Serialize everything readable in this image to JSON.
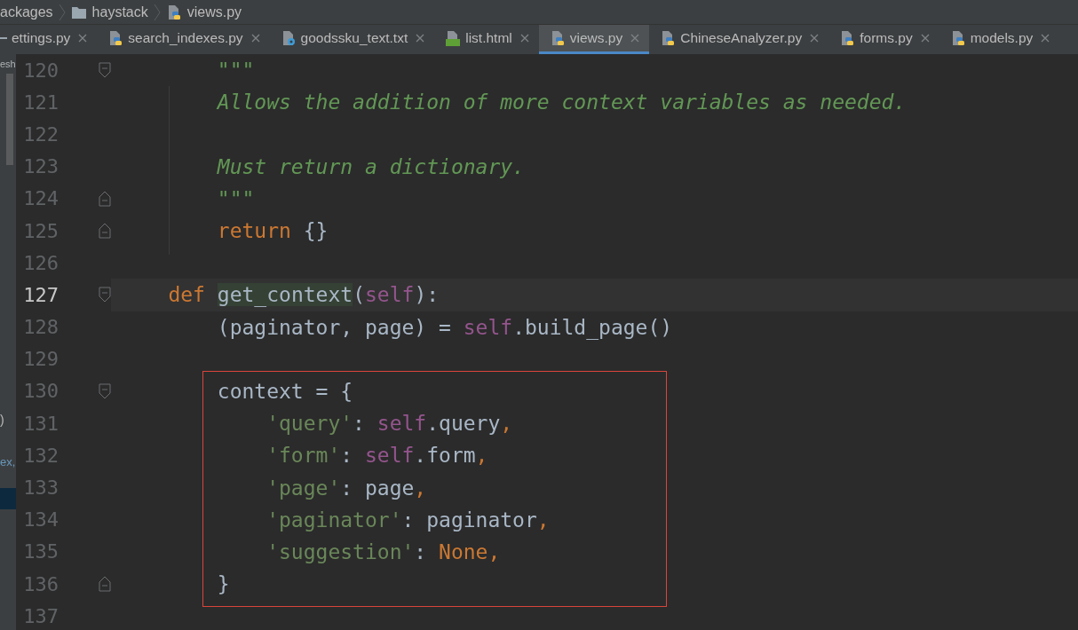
{
  "breadcrumb": [
    {
      "text": "ackages",
      "kind": "plain"
    },
    {
      "text": "haystack",
      "kind": "folder"
    },
    {
      "text": "views.py",
      "kind": "python"
    }
  ],
  "tabs": [
    {
      "label": "ettings.py",
      "kind": "cut",
      "selected": false
    },
    {
      "label": "search_indexes.py",
      "kind": "python",
      "selected": false
    },
    {
      "label": "goodssku_text.txt",
      "kind": "text",
      "selected": false
    },
    {
      "label": "list.html",
      "kind": "html",
      "selected": false
    },
    {
      "label": "views.py",
      "kind": "python",
      "selected": true
    },
    {
      "label": "ChineseAnalyzer.py",
      "kind": "python",
      "selected": false
    },
    {
      "label": "forms.py",
      "kind": "python",
      "selected": false
    },
    {
      "label": "models.py",
      "kind": "python",
      "selected": false
    }
  ],
  "side_panel": {
    "items": [
      {
        "text": "esh",
        "selected": false
      },
      {
        "text": ")",
        "selected": false
      },
      {
        "text": "ex,",
        "selected": false
      },
      {
        "selected": true
      }
    ]
  },
  "editor": {
    "lines": [
      {
        "kind": "line",
        "number": "120",
        "fold_start": true,
        "tokens": [
          {
            "kind": "docstring",
            "text": "        \"\"\""
          }
        ]
      },
      {
        "kind": "line",
        "number": "121",
        "tokens": [
          {
            "kind": "docstring",
            "text": "        Allows the addition of more context variables as needed."
          }
        ]
      },
      {
        "kind": "line",
        "number": "122"
      },
      {
        "kind": "line",
        "number": "123",
        "tokens": [
          {
            "kind": "docstring",
            "text": "        Must return a dictionary."
          }
        ]
      },
      {
        "kind": "line",
        "number": "124",
        "fold_end": true,
        "tokens": [
          {
            "kind": "docstring",
            "text": "        \"\"\""
          }
        ]
      },
      {
        "kind": "line",
        "number": "125",
        "fold_end": true,
        "tokens": [
          {
            "kind": "keyword",
            "text": "        return"
          },
          {
            "kind": "plain",
            "text": " {}"
          }
        ]
      },
      {
        "kind": "line",
        "number": "126"
      },
      {
        "kind": "line",
        "number": "127",
        "fold_start": true,
        "current": true,
        "tokens": [
          {
            "kind": "keyword",
            "text": "    def"
          },
          {
            "kind": "function",
            "text": " get_context",
            "highlighted": true,
            "caret": true
          },
          {
            "kind": "plain",
            "text": "("
          },
          {
            "kind": "self",
            "text": "self"
          },
          {
            "kind": "plain",
            "text": "):"
          }
        ]
      },
      {
        "kind": "line",
        "number": "128",
        "tokens": [
          {
            "kind": "plain",
            "text": "        (paginator, page) = "
          },
          {
            "kind": "self",
            "text": "self"
          },
          {
            "kind": "plain",
            "text": ".build_page()"
          }
        ]
      },
      {
        "kind": "line",
        "number": "129"
      },
      {
        "kind": "box",
        "lines": [
          {
            "kind": "line",
            "number": "130",
            "fold_start": true,
            "tokens": [
              {
                "kind": "plain",
                "text": "        context = {"
              }
            ]
          },
          {
            "kind": "line",
            "number": "131",
            "tokens": [
              {
                "kind": "string",
                "text": "            'query'"
              },
              {
                "kind": "plain",
                "text": ": "
              },
              {
                "kind": "self",
                "text": "self"
              },
              {
                "kind": "plain",
                "text": ".query"
              },
              {
                "kind": "punct",
                "text": ","
              }
            ]
          },
          {
            "kind": "line",
            "number": "132",
            "tokens": [
              {
                "kind": "string",
                "text": "            'form'"
              },
              {
                "kind": "plain",
                "text": ": "
              },
              {
                "kind": "self",
                "text": "self"
              },
              {
                "kind": "plain",
                "text": ".form"
              },
              {
                "kind": "punct",
                "text": ","
              }
            ]
          },
          {
            "kind": "line",
            "number": "133",
            "tokens": [
              {
                "kind": "string",
                "text": "            'page'"
              },
              {
                "kind": "plain",
                "text": ": page"
              },
              {
                "kind": "punct",
                "text": ","
              }
            ]
          },
          {
            "kind": "line",
            "number": "134",
            "tokens": [
              {
                "kind": "string",
                "text": "            'paginator'"
              },
              {
                "kind": "plain",
                "text": ": paginator"
              },
              {
                "kind": "punct",
                "text": ","
              }
            ]
          },
          {
            "kind": "line",
            "number": "135",
            "tokens": [
              {
                "kind": "string",
                "text": "            'suggestion'"
              },
              {
                "kind": "plain",
                "text": ": "
              },
              {
                "kind": "keyword",
                "text": "None"
              },
              {
                "kind": "punct",
                "text": ","
              }
            ]
          },
          {
            "kind": "line",
            "number": "136",
            "fold_end": true,
            "tokens": [
              {
                "kind": "plain",
                "text": "        }"
              }
            ]
          }
        ]
      },
      {
        "kind": "line",
        "number": "137"
      }
    ]
  }
}
